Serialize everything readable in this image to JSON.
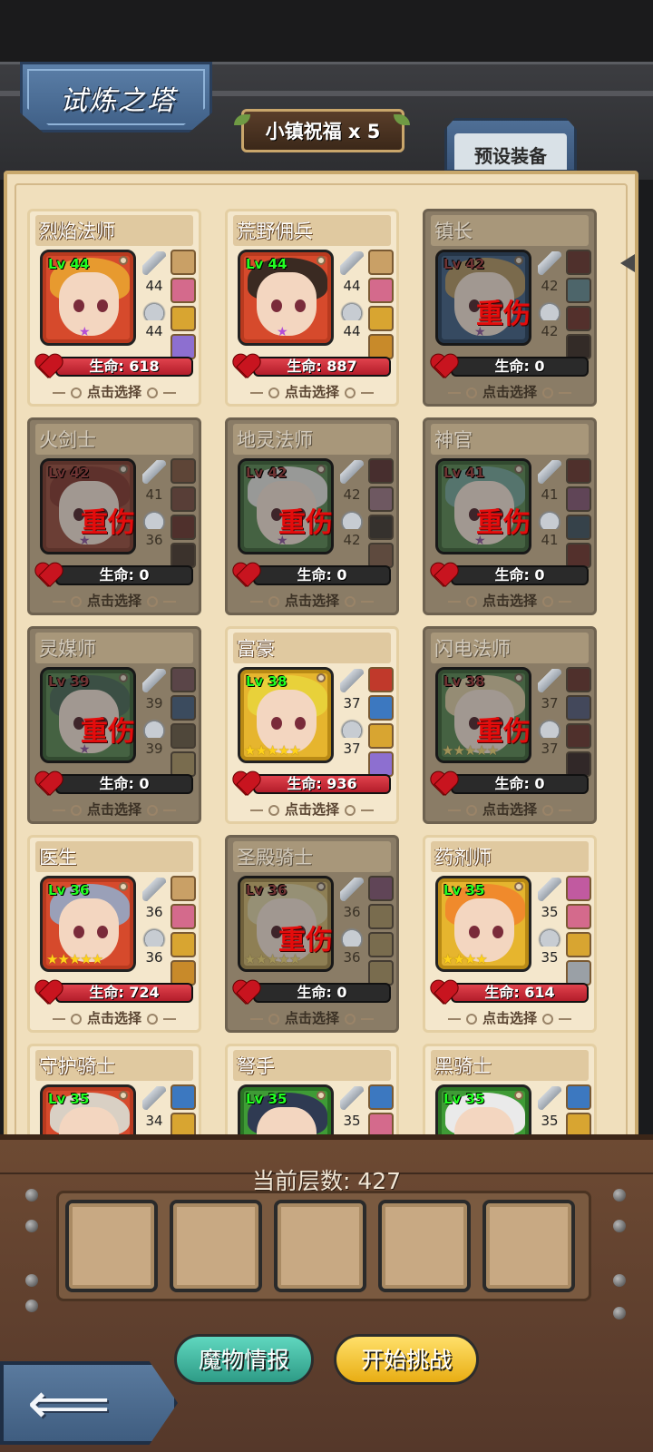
{
  "header": {
    "title": "试炼之塔",
    "blessing": "小镇祝福 x 5",
    "preset_equipment": "预设装备"
  },
  "heroes": [
    {
      "name": "烈焰法师",
      "level": "Lv 44",
      "attack": "44",
      "defense": "44",
      "hp_text": "生命: 618",
      "hp_ratio": 1.0,
      "frame": "red",
      "hair": "#e79a2f",
      "injured": false,
      "stars": "",
      "select": "点击选择"
    },
    {
      "name": "荒野佣兵",
      "level": "Lv 44",
      "attack": "44",
      "defense": "44",
      "hp_text": "生命: 887",
      "hp_ratio": 1.0,
      "frame": "red",
      "hair": "#3a2a22",
      "injured": false,
      "stars": "",
      "select": "点击选择"
    },
    {
      "name": "镇长",
      "level": "Lv 42",
      "attack": "42",
      "defense": "42",
      "hp_text": "生命: 0",
      "hp_ratio": 0.0,
      "frame": "blue",
      "hair": "#c99535",
      "injured": true,
      "injury": "重伤",
      "stars": "",
      "select": "点击选择"
    },
    {
      "name": "火剑士",
      "level": "Lv 42",
      "attack": "41",
      "defense": "36",
      "hp_text": "生命: 0",
      "hp_ratio": 0.0,
      "frame": "red",
      "hair": "#c63525",
      "injured": true,
      "injury": "重伤",
      "stars": "",
      "select": "点击选择"
    },
    {
      "name": "地灵法师",
      "level": "Lv 42",
      "attack": "42",
      "defense": "42",
      "hp_text": "生命: 0",
      "hp_ratio": 0.0,
      "frame": "green",
      "hair": "#d7dbd4",
      "injured": true,
      "injury": "重伤",
      "stars": "",
      "select": "点击选择"
    },
    {
      "name": "神官",
      "level": "Lv 41",
      "attack": "41",
      "defense": "41",
      "hp_text": "生命: 0",
      "hp_ratio": 0.0,
      "frame": "green",
      "hair": "#4fb39a",
      "injured": true,
      "injury": "重伤",
      "stars": "",
      "select": "点击选择"
    },
    {
      "name": "灵媒师",
      "level": "Lv 39",
      "attack": "39",
      "defense": "39",
      "hp_text": "生命: 0",
      "hp_ratio": 0.0,
      "frame": "green",
      "hair": "#3b7a55",
      "injured": true,
      "injury": "重伤",
      "stars": "",
      "select": "点击选择"
    },
    {
      "name": "富豪",
      "level": "Lv 38",
      "attack": "37",
      "defense": "37",
      "hp_text": "生命: 936",
      "hp_ratio": 1.0,
      "frame": "gold",
      "hair": "#e8d13a",
      "injured": false,
      "stars": "★★★★★",
      "select": "点击选择"
    },
    {
      "name": "闪电法师",
      "level": "Lv 38",
      "attack": "37",
      "defense": "37",
      "hp_text": "生命: 0",
      "hp_ratio": 0.0,
      "frame": "green",
      "hair": "#e3c87c",
      "injured": true,
      "injury": "重伤",
      "stars": "★★★★★",
      "select": "点击选择"
    },
    {
      "name": "医生",
      "level": "Lv 36",
      "attack": "36",
      "defense": "36",
      "hp_text": "生命: 724",
      "hp_ratio": 1.0,
      "frame": "red",
      "hair": "#9aa0b8",
      "injured": false,
      "stars": "★★★★★",
      "select": "点击选择"
    },
    {
      "name": "圣殿骑士",
      "level": "Lv 36",
      "attack": "36",
      "defense": "36",
      "hp_text": "生命: 0",
      "hp_ratio": 0.0,
      "frame": "gold",
      "hair": "#e3cf7a",
      "injured": true,
      "injury": "重伤",
      "stars": "★★★★★",
      "select": "点击选择"
    },
    {
      "name": "药剂师",
      "level": "Lv 35",
      "attack": "35",
      "defense": "35",
      "hp_text": "生命: 614",
      "hp_ratio": 1.0,
      "frame": "gold",
      "hair": "#f08a2c",
      "injured": false,
      "stars": "★★★★",
      "select": "点击选择"
    },
    {
      "name": "守护骑士",
      "level": "Lv 35",
      "attack": "34",
      "defense": "",
      "hp_text": "",
      "hp_ratio": 1.0,
      "frame": "red",
      "hair": "#d9d0c4",
      "injured": false,
      "stars": "",
      "select": ""
    },
    {
      "name": "弩手",
      "level": "Lv 35",
      "attack": "35",
      "defense": "",
      "hp_text": "",
      "hp_ratio": 1.0,
      "frame": "green",
      "hair": "#2f3a52",
      "injured": false,
      "stars": "",
      "select": ""
    },
    {
      "name": "黑骑士",
      "level": "Lv 35",
      "attack": "35",
      "defense": "",
      "hp_text": "",
      "hp_ratio": 1.0,
      "frame": "green",
      "hair": "#eaeaea",
      "injured": false,
      "stars": "",
      "select": ""
    }
  ],
  "bottom": {
    "current_floor": "当前层数: 427",
    "monster_info": "魔物情报",
    "start_challenge": "开始挑战",
    "back": "⟸"
  },
  "colors": {
    "hp": "#c8202d",
    "injury": "#e40c0c",
    "level": "#22ff22"
  }
}
